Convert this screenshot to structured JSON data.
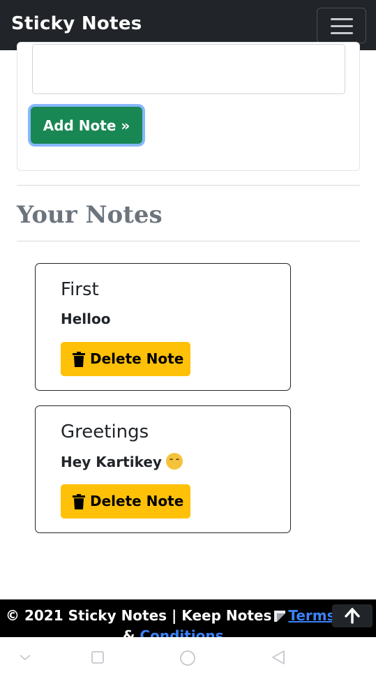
{
  "navbar": {
    "brand": "Sticky Notes",
    "toggler_icon": "hamburger-icon"
  },
  "form": {
    "textarea_value": "",
    "add_button_label": "Add Note »"
  },
  "notes_section": {
    "title": "Your Notes"
  },
  "notes": [
    {
      "title": "First",
      "text": "Helloo",
      "delete_label": "Delete Note",
      "delete_icon": "trash-icon"
    },
    {
      "title": "Greetings",
      "text": "Hey Kartikey",
      "emoji_icon": "hugging-face-icon",
      "delete_label": "Delete Note",
      "delete_icon": "trash-icon"
    }
  ],
  "footer": {
    "text": "© 2021 Sticky Notes | Keep Notes",
    "note_icon": "note-icon",
    "terms_link": "Terms",
    "amp": "&",
    "conditions_link": "Conditions",
    "back_to_top_icon": "arrow-up-icon"
  },
  "system_nav": {
    "icons": [
      "chevron-down-icon",
      "square-icon",
      "circle-icon",
      "triangle-back-icon"
    ]
  },
  "colors": {
    "navbar_bg": "#212529",
    "add_button": "#198754",
    "delete_button": "#ffc107",
    "link": "#3b82f6"
  }
}
